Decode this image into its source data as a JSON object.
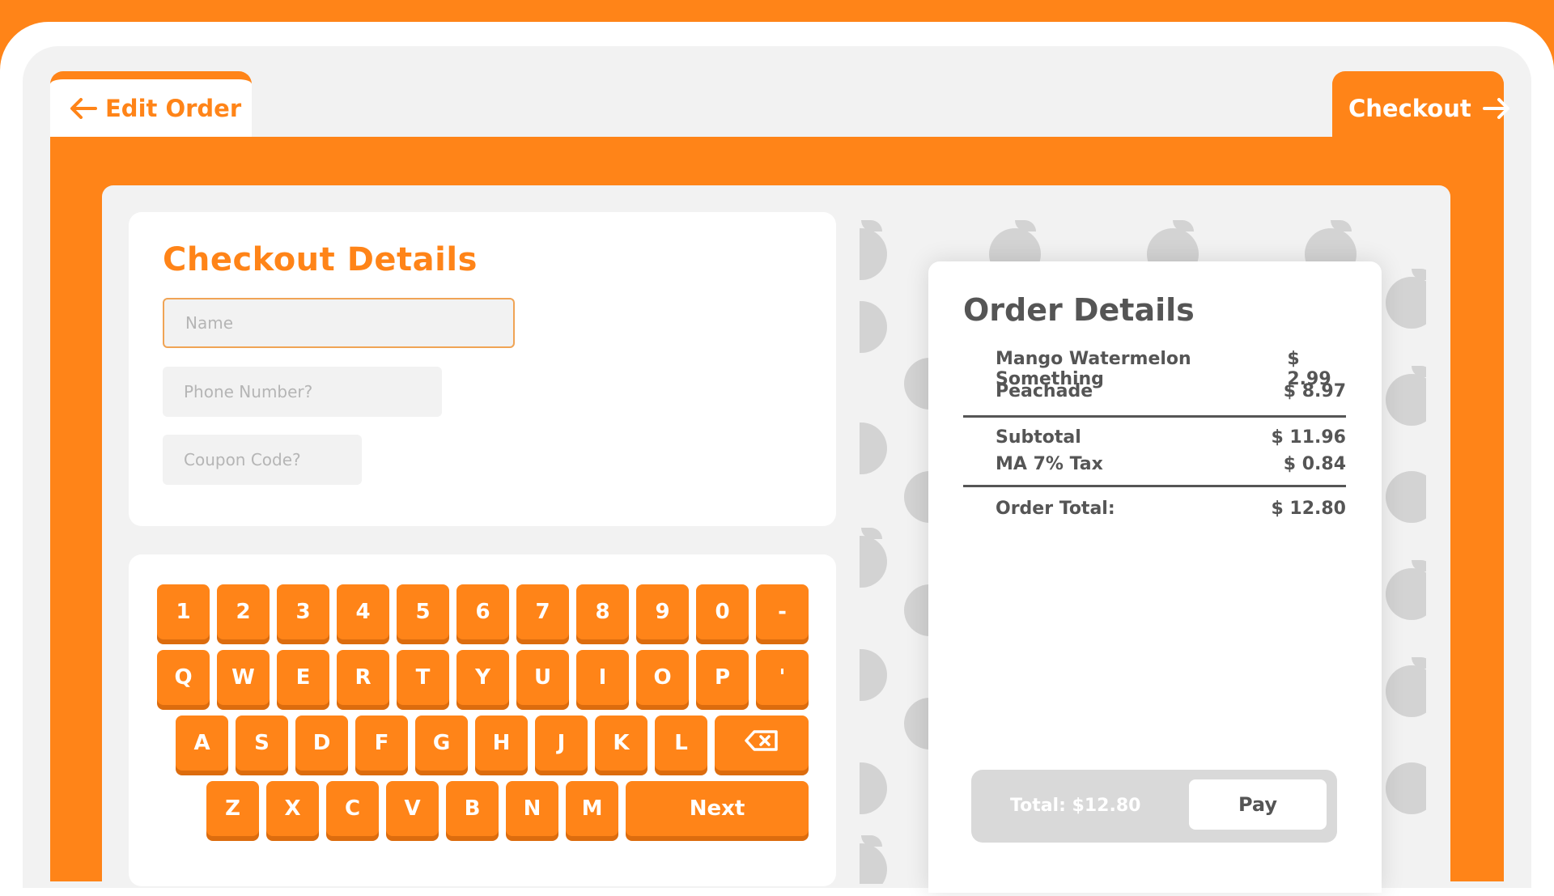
{
  "colors": {
    "accent": "#FF8418",
    "key_shadow": "#DC6C0E",
    "text_dark": "#555555",
    "panel_bg": "#F2F2F2"
  },
  "tabs": {
    "edit_order": {
      "label": "Edit Order",
      "icon": "arrow-left-icon"
    },
    "checkout": {
      "label": "Checkout",
      "icon": "arrow-right-icon"
    }
  },
  "checkout_details": {
    "title": "Checkout Details",
    "name_placeholder": "Name",
    "phone_placeholder": "Phone Number?",
    "coupon_placeholder": "Coupon Code?"
  },
  "keyboard": {
    "rows": [
      [
        "1",
        "2",
        "3",
        "4",
        "5",
        "6",
        "7",
        "8",
        "9",
        "0",
        "-"
      ],
      [
        "Q",
        "W",
        "E",
        "R",
        "T",
        "Y",
        "U",
        "I",
        "O",
        "P",
        "'"
      ],
      [
        "A",
        "S",
        "D",
        "F",
        "G",
        "H",
        "J",
        "K",
        "L"
      ],
      [
        "Z",
        "X",
        "C",
        "V",
        "B",
        "N",
        "M"
      ]
    ],
    "backspace_icon": "backspace-icon",
    "next_label": "Next"
  },
  "order": {
    "title": "Order Details",
    "items": [
      {
        "name": "Mango Watermelon Something",
        "price": "$ 2.99"
      },
      {
        "name": "Peachade",
        "price": "$ 8.97"
      }
    ],
    "subtotal_label": "Subtotal",
    "subtotal_value": "$ 11.96",
    "tax_label": "MA 7% Tax",
    "tax_value": "$ 0.84",
    "total_label": "Order Total:",
    "total_value": "$ 12.80"
  },
  "pay_bar": {
    "total_text": "Total: $12.80",
    "pay_label": "Pay"
  },
  "background_icons": [
    "apple-icon",
    "pear-icon",
    "cherry-icon",
    "banana-icon"
  ]
}
